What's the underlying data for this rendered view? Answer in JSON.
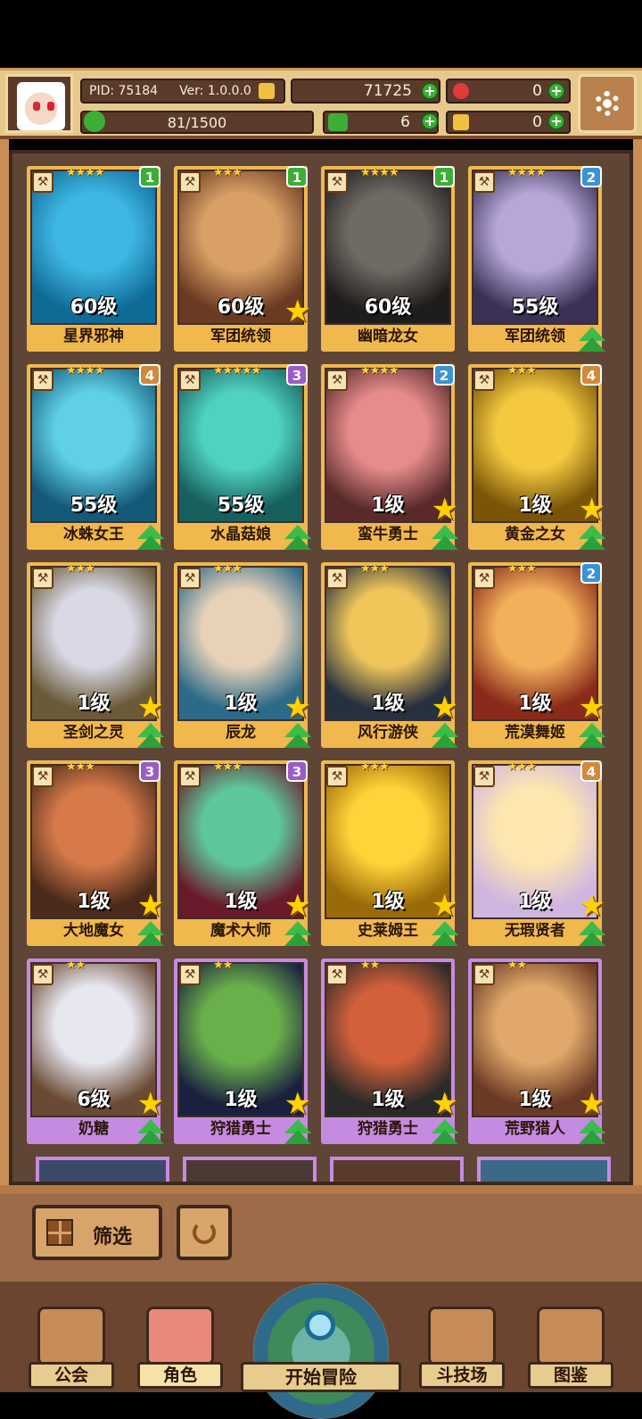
{
  "header": {
    "pid": "PID: 75184",
    "version": "Ver: 1.0.0.0",
    "gold": "71725",
    "gems": "0",
    "energy": "81/1500",
    "clover": "6",
    "keys": "0"
  },
  "cards": [
    {
      "name": "星界邪神",
      "level": "60级",
      "stars": "★★★★",
      "badge": "1",
      "badge_color": "#3cae36",
      "frame": "gold",
      "bigstar": false,
      "up": false,
      "art": [
        "#3fb7e3",
        "#0f6a96"
      ]
    },
    {
      "name": "军团统领",
      "level": "60级",
      "stars": "★★★",
      "badge": "1",
      "badge_color": "#3cae36",
      "frame": "gold",
      "bigstar": true,
      "up": false,
      "art": [
        "#d9a066",
        "#6a3a22"
      ]
    },
    {
      "name": "幽暗龙女",
      "level": "60级",
      "stars": "★★★★",
      "badge": "1",
      "badge_color": "#3cae36",
      "frame": "gold",
      "bigstar": false,
      "up": false,
      "art": [
        "#6f6a64",
        "#1f1d1c"
      ]
    },
    {
      "name": "军团统领",
      "level": "55级",
      "stars": "★★★★",
      "badge": "2",
      "badge_color": "#3a93d6",
      "frame": "gold",
      "bigstar": false,
      "up": true,
      "art": [
        "#b6a7d8",
        "#3a3155"
      ]
    },
    {
      "name": "冰蛛女王",
      "level": "55级",
      "stars": "★★★★",
      "badge": "4",
      "badge_color": "#d4893a",
      "frame": "gold",
      "bigstar": false,
      "up": true,
      "art": [
        "#5fd0e6",
        "#145a78"
      ]
    },
    {
      "name": "水晶菇娘",
      "level": "55级",
      "stars": "★★★★★",
      "badge": "3",
      "badge_color": "#9a5cc9",
      "frame": "gold",
      "bigstar": false,
      "up": true,
      "art": [
        "#4fd3c0",
        "#17605d"
      ]
    },
    {
      "name": "蛮牛勇士",
      "level": "1级",
      "stars": "★★★★",
      "badge": "2",
      "badge_color": "#3a93d6",
      "frame": "gold",
      "bigstar": true,
      "up": true,
      "art": [
        "#e78c8c",
        "#5a2a2a"
      ]
    },
    {
      "name": "黄金之女",
      "level": "1级",
      "stars": "★★★",
      "badge": "4",
      "badge_color": "#d4893a",
      "frame": "gold",
      "bigstar": true,
      "up": true,
      "art": [
        "#f4c940",
        "#7a5508"
      ]
    },
    {
      "name": "圣剑之灵",
      "level": "1级",
      "stars": "★★★",
      "badge": "",
      "badge_color": "",
      "frame": "gold",
      "bigstar": true,
      "up": true,
      "art": [
        "#d9d9e6",
        "#6a5a3a"
      ]
    },
    {
      "name": "辰龙",
      "level": "1级",
      "stars": "★★★",
      "badge": "",
      "badge_color": "",
      "frame": "gold",
      "bigstar": true,
      "up": true,
      "art": [
        "#e7d2b8",
        "#2d6a88"
      ]
    },
    {
      "name": "风行游侠",
      "level": "1级",
      "stars": "★★★",
      "badge": "",
      "badge_color": "",
      "frame": "gold",
      "bigstar": true,
      "up": true,
      "art": [
        "#f0c65a",
        "#26303f"
      ]
    },
    {
      "name": "荒漠舞姬",
      "level": "1级",
      "stars": "★★★",
      "badge": "2",
      "badge_color": "#3a93d6",
      "frame": "gold",
      "bigstar": true,
      "up": true,
      "art": [
        "#f2b05a",
        "#8a2a1a"
      ]
    },
    {
      "name": "大地魔女",
      "level": "1级",
      "stars": "★★★",
      "badge": "3",
      "badge_color": "#9a5cc9",
      "frame": "gold",
      "bigstar": true,
      "up": true,
      "art": [
        "#d67a4a",
        "#4a2a1a"
      ]
    },
    {
      "name": "魔术大师",
      "level": "1级",
      "stars": "★★★",
      "badge": "3",
      "badge_color": "#9a5cc9",
      "frame": "gold",
      "bigstar": true,
      "up": true,
      "art": [
        "#5ec79a",
        "#6a1a2a"
      ]
    },
    {
      "name": "史莱姆王",
      "level": "1级",
      "stars": "★★★",
      "badge": "",
      "badge_color": "",
      "frame": "gold",
      "bigstar": true,
      "up": true,
      "art": [
        "#ffd43a",
        "#9a6a08"
      ]
    },
    {
      "name": "无瑕贤者",
      "level": "1级",
      "stars": "★★★",
      "badge": "4",
      "badge_color": "#d4893a",
      "frame": "gold",
      "bigstar": true,
      "up": true,
      "art": [
        "#fde6b0",
        "#cfb6e0"
      ]
    },
    {
      "name": "奶糖",
      "level": "6级",
      "stars": "★★",
      "badge": "",
      "badge_color": "",
      "frame": "purple",
      "bigstar": true,
      "up": true,
      "art": [
        "#e7e7f0",
        "#6a4a34"
      ]
    },
    {
      "name": "狩猎勇士",
      "level": "1级",
      "stars": "★★",
      "badge": "",
      "badge_color": "",
      "frame": "purple",
      "bigstar": true,
      "up": true,
      "art": [
        "#6ab04a",
        "#1a2040"
      ]
    },
    {
      "name": "狩猎勇士",
      "level": "1级",
      "stars": "★★",
      "badge": "",
      "badge_color": "",
      "frame": "purple",
      "bigstar": true,
      "up": true,
      "art": [
        "#d2603a",
        "#2a2a2a"
      ]
    },
    {
      "name": "荒野猎人",
      "level": "1级",
      "stars": "★★",
      "badge": "",
      "badge_color": "",
      "frame": "purple",
      "bigstar": true,
      "up": true,
      "art": [
        "#e0a86a",
        "#6a3a24"
      ]
    }
  ],
  "filter": {
    "label": "筛选"
  },
  "nav": {
    "guild": "公会",
    "character": "角色",
    "adventure": "开始冒险",
    "arena": "斗技场",
    "codex": "图鉴"
  }
}
